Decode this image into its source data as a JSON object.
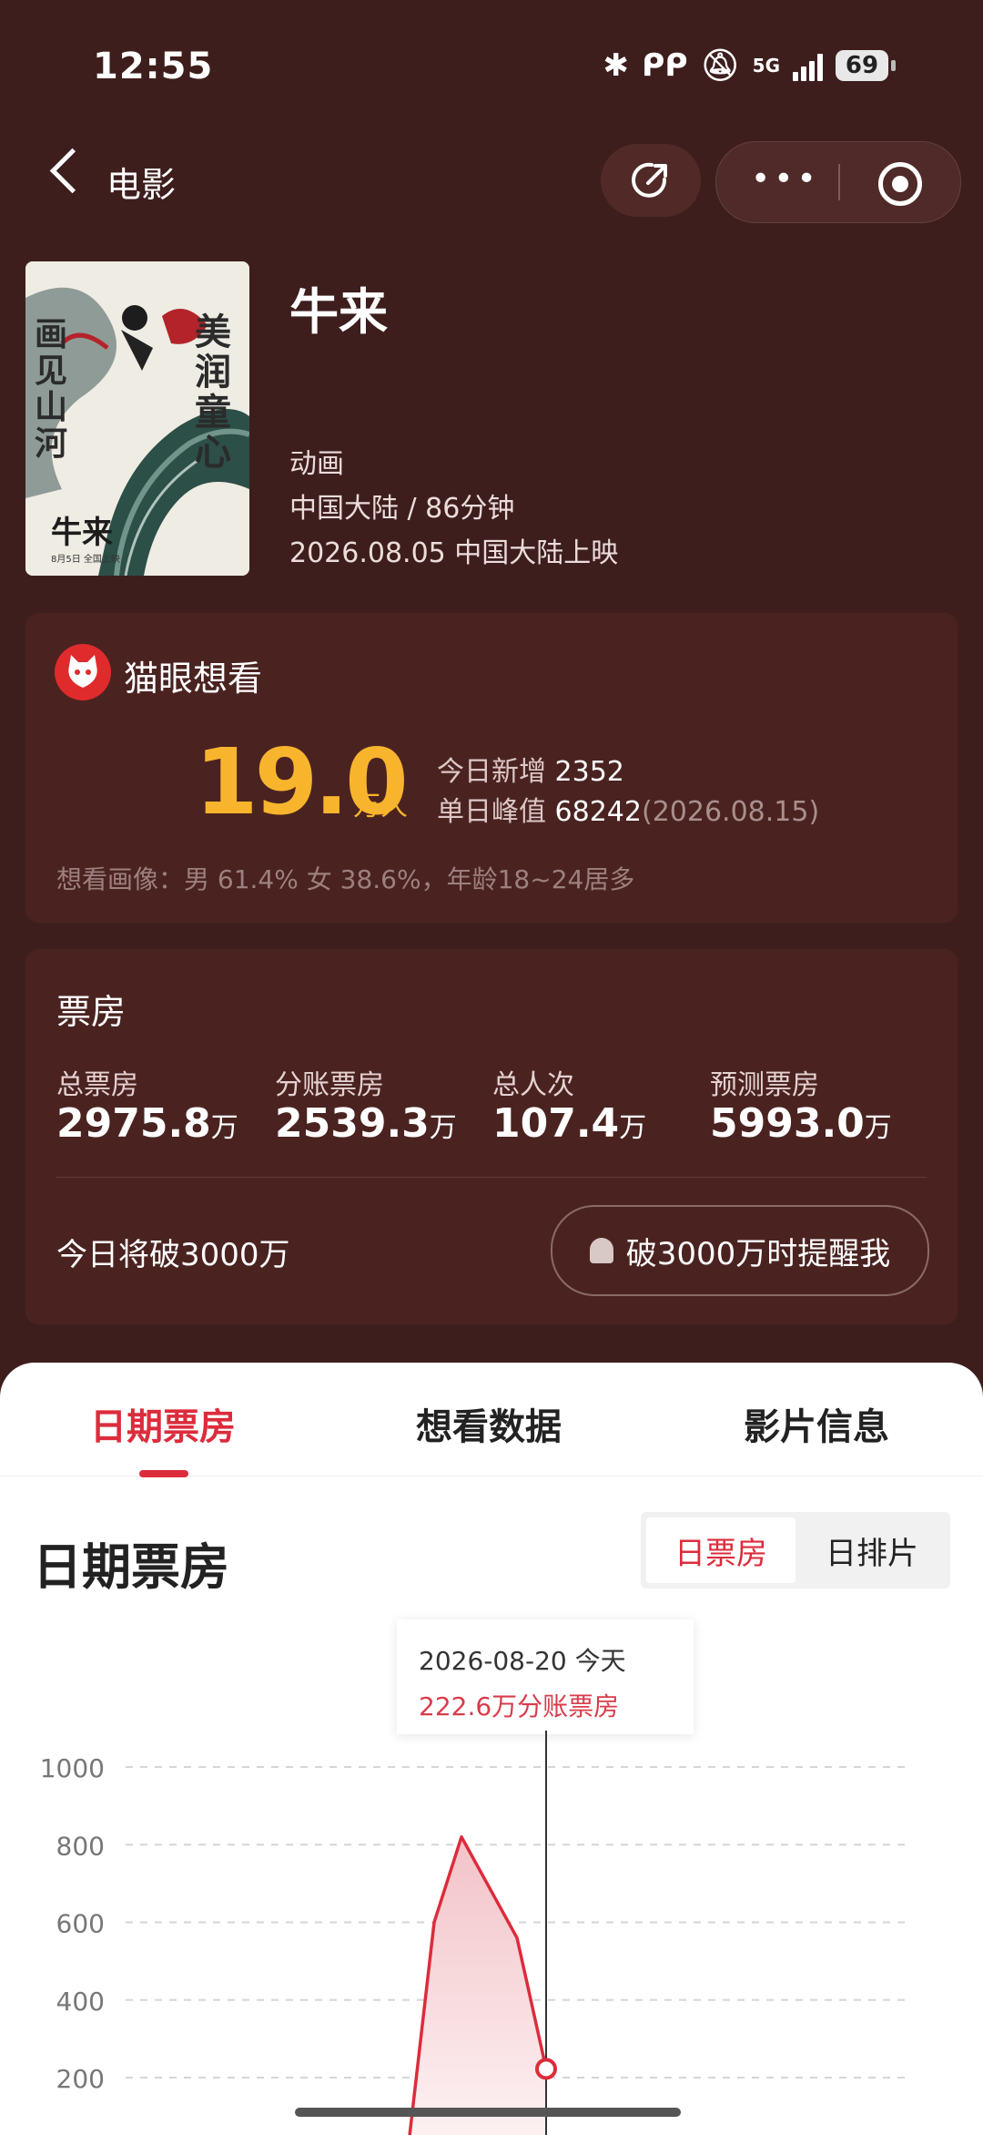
{
  "status": {
    "time": "12:55",
    "network": "5G",
    "battery": "69"
  },
  "nav": {
    "back_label": "电影"
  },
  "movie": {
    "title": "牛来",
    "genre": "动画",
    "region_duration": "中国大陆 / 86分钟",
    "release": "2026.08.05 中国大陆上映",
    "poster_text": {
      "top_right": "美润童心",
      "left": "画见山河",
      "bottom": "牛来",
      "date": "8月5日 全国上映"
    }
  },
  "want": {
    "title": "猫眼想看",
    "count": "19.0",
    "unit": "万人",
    "today_label": "今日新增",
    "today_value": "2352",
    "peak_label": "单日峰值",
    "peak_value": "68242",
    "peak_date": "(2026.08.15)",
    "portrait": "想看画像：男 61.4% 女 38.6%，年龄18~24居多"
  },
  "boxoffice": {
    "title": "票房",
    "stats": [
      {
        "label": "总票房",
        "value": "2975.8",
        "unit": "万"
      },
      {
        "label": "分账票房",
        "value": "2539.3",
        "unit": "万"
      },
      {
        "label": "总人次",
        "value": "107.4",
        "unit": "万"
      },
      {
        "label": "预测票房",
        "value": "5993.0",
        "unit": "万"
      }
    ],
    "break_text": "今日将破3000万",
    "remind_label": "破3000万时提醒我"
  },
  "tabs": [
    {
      "label": "日期票房",
      "active": true
    },
    {
      "label": "想看数据",
      "active": false
    },
    {
      "label": "影片信息",
      "active": false
    }
  ],
  "section": {
    "title": "日期票房",
    "toggle": [
      {
        "label": "日票房",
        "selected": true
      },
      {
        "label": "日排片",
        "selected": false
      }
    ]
  },
  "tooltip": {
    "date": "2026-08-20 今天",
    "value": "222.6万分账票房"
  },
  "colors": {
    "accent": "#dc2c3c",
    "gold": "#f8b42d",
    "background": "#3d1e1d"
  },
  "chart_data": {
    "type": "area",
    "y_ticks": [
      "1000",
      "800",
      "600",
      "400",
      "200"
    ],
    "y_values": [
      1000,
      800,
      600,
      400,
      200
    ],
    "ylim": [
      100,
      1000
    ],
    "series": [
      {
        "values": [
          50,
          600,
          820,
          560,
          222.6
        ]
      }
    ],
    "highlight_index": 4
  }
}
